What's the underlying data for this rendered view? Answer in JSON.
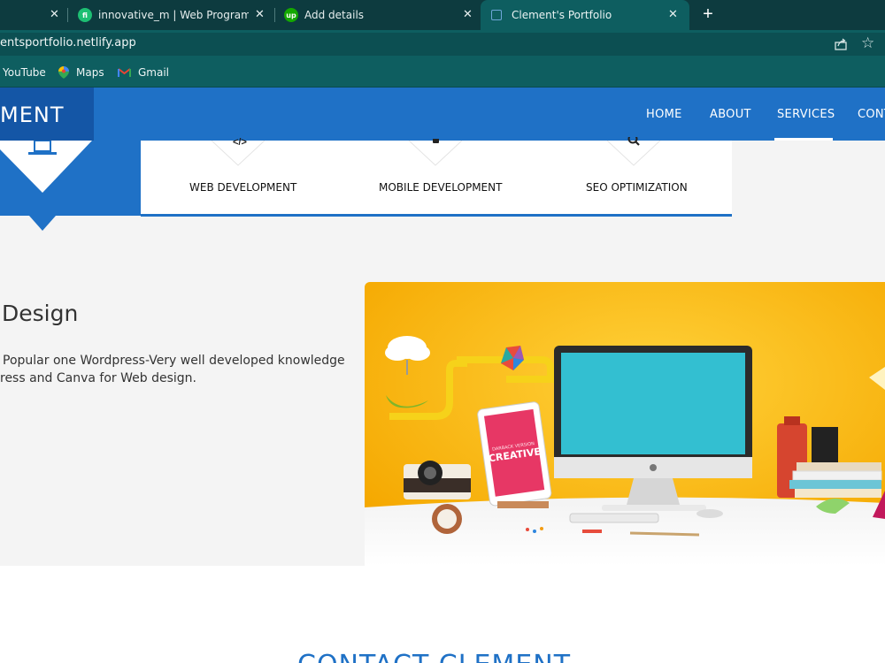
{
  "browser": {
    "tabs": [
      {
        "title": "",
        "close": "✕"
      },
      {
        "title": "innovative_m | Web Programmin",
        "close": "✕",
        "favicon_text": "fi",
        "favicon_color": "#1dbf73"
      },
      {
        "title": "Add details",
        "close": "✕",
        "favicon_text": "up",
        "favicon_color": "#14a800"
      },
      {
        "title": "Clement's Portfolio",
        "close": "✕",
        "active": true
      }
    ],
    "new_tab": "+",
    "url": "entsportfolio.netlify.app",
    "share_icon": "share-icon",
    "star_icon": "star-icon",
    "bookmarks": [
      {
        "label": "YouTube"
      },
      {
        "label": "Maps",
        "icon": "maps-pin-icon"
      },
      {
        "label": "Gmail",
        "icon": "gmail-icon"
      }
    ],
    "colors": {
      "tabbar": "#0d3b3f",
      "toolbar": "#0e5e60"
    }
  },
  "site": {
    "logo": "MENT",
    "nav": [
      {
        "label": "HOME"
      },
      {
        "label": "ABOUT"
      },
      {
        "label": "SERVICES",
        "active": true
      },
      {
        "label": "CONT"
      }
    ],
    "services": [
      {
        "label": "WEB DEVELOPMENT",
        "icon": "code-icon"
      },
      {
        "label": "MOBILE DEVELOPMENT",
        "icon": "mobile-icon"
      },
      {
        "label": "SEO OPTIMIZATION",
        "icon": "search-icon"
      }
    ],
    "design": {
      "title": "Design",
      "line1": "Popular one Wordpress-Very well developed knowledge",
      "line2": "ress and Canva for Web design."
    },
    "hero": {
      "tablet_text_top": "DARBACK VERSION",
      "tablet_text": "CREATIVE"
    },
    "contact_title": "CONTACT CLEMENT",
    "colors": {
      "primary": "#1f71c6",
      "primary_dark": "#1456a6",
      "hero_bg": "#f7b500"
    }
  }
}
